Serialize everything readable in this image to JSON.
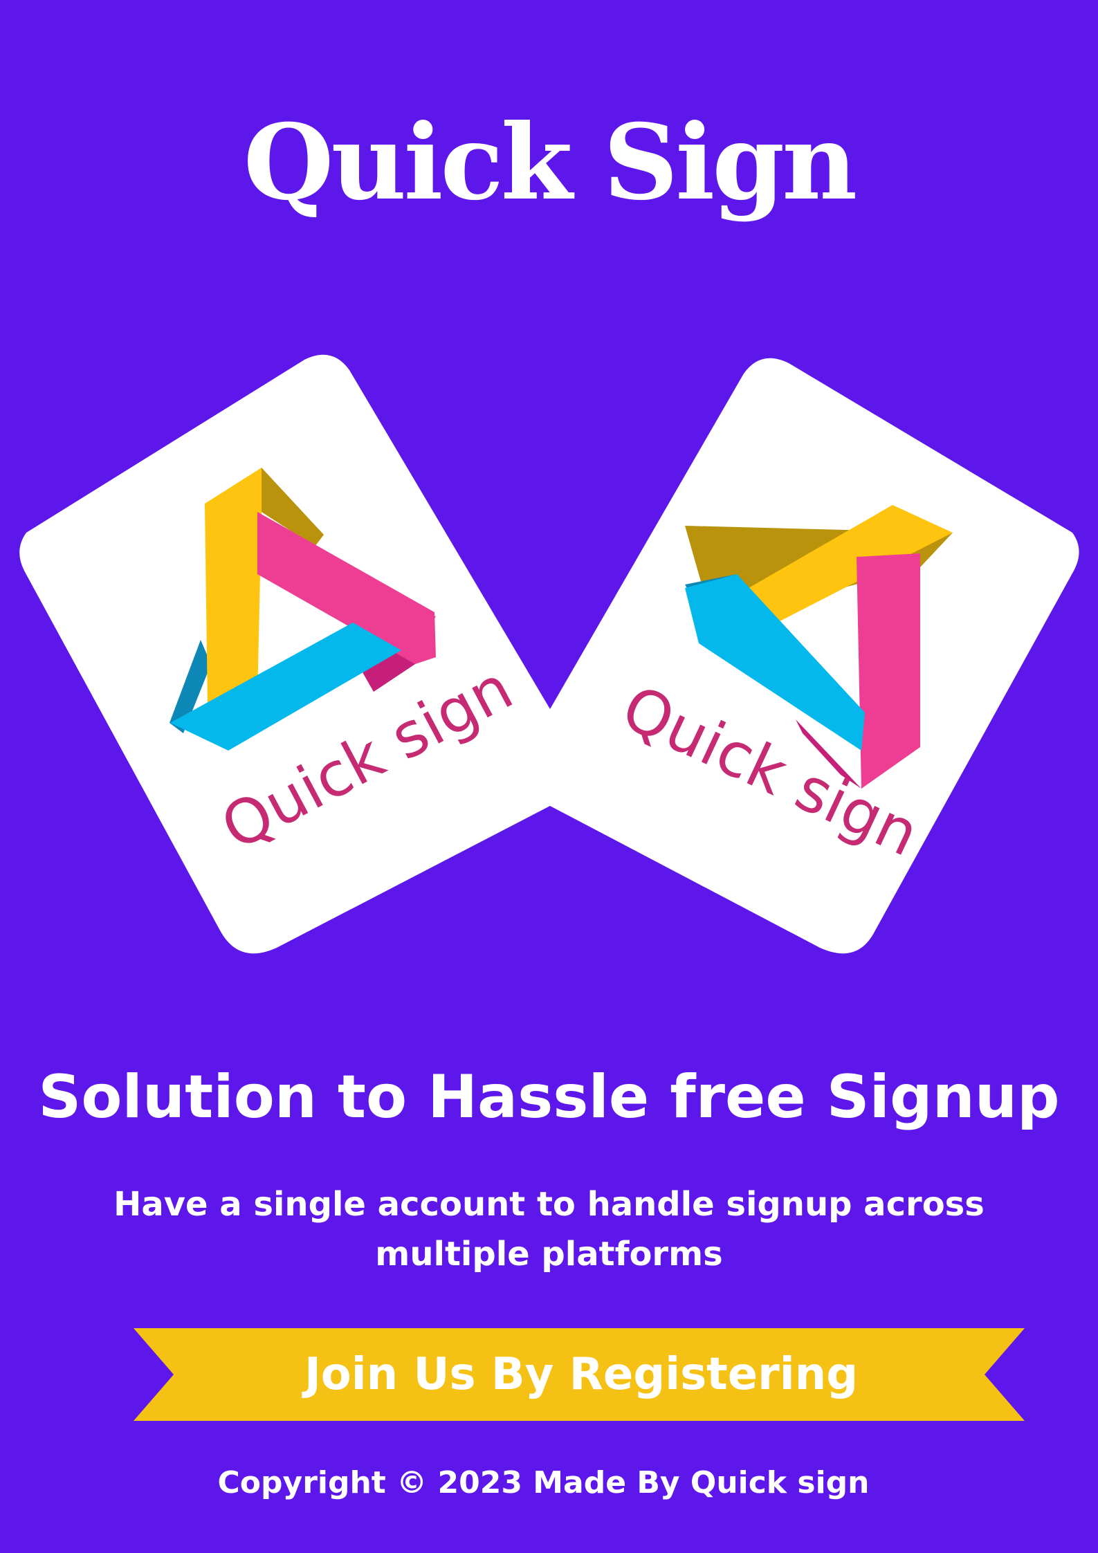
{
  "header": {
    "title": "Quick Sign"
  },
  "cards": [
    {
      "logo_text": "Quick sign",
      "icon": "triangle-ribbon-logo-icon"
    },
    {
      "logo_text": "Quick sign",
      "icon": "triangle-ribbon-logo-icon"
    }
  ],
  "hero": {
    "headline": "Solution to Hassle free Signup",
    "subtext_line1": "Have a single account to handle signup across",
    "subtext_line2": "multiple platforms"
  },
  "cta": {
    "label": "Join Us By Registering"
  },
  "footer": {
    "copyright": "Copyright © 2023 Made By Quick sign"
  },
  "colors": {
    "background": "#5e17eb",
    "card": "#ffffff",
    "banner": "#f5c115",
    "logo_yellow": "#fec40f",
    "logo_pink": "#ee3e94",
    "logo_blue": "#05b8ec",
    "logo_text": "#c52a73"
  }
}
